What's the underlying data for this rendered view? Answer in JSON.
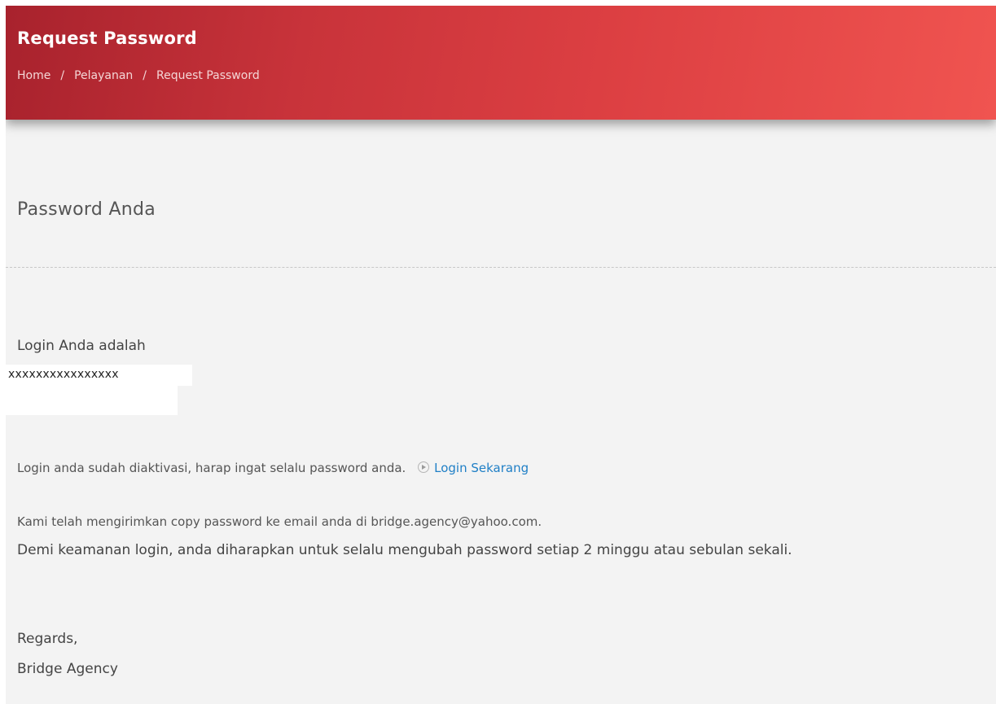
{
  "header": {
    "title": "Request Password",
    "breadcrumb": [
      {
        "label": "Home"
      },
      {
        "label": "Pelayanan"
      },
      {
        "label": "Request Password"
      }
    ],
    "breadcrumb_separator": "/"
  },
  "content": {
    "section_title": "Password Anda",
    "login_label": "Login Anda adalah",
    "login_value": "xxxxxxxxxxxxxxxx",
    "activated_text": "Login anda sudah diaktivasi, harap ingat selalu password anda.",
    "login_now_link": "Login Sekarang",
    "login_now_icon": "play-circle-icon",
    "copy_sent_text": "Kami telah mengirimkan copy password ke email anda di bridge.agency@yahoo.com.",
    "security_notice": "Demi keamanan login, anda diharapkan untuk selalu mengubah password setiap 2 minggu atau sebulan sekali.",
    "regards": "Regards,",
    "signature": "Bridge Agency"
  },
  "colors": {
    "header_gradient_start": "#a8222d",
    "header_gradient_end": "#f05450",
    "page_background": "#f3f3f3",
    "link": "#1f7fc6"
  }
}
